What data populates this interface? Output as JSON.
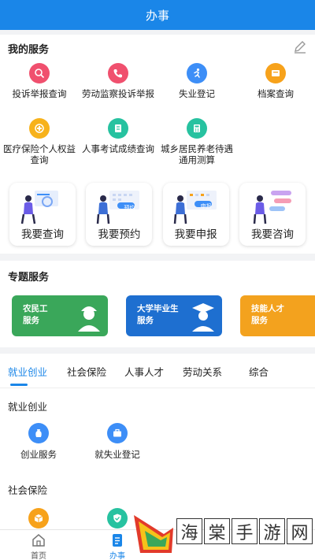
{
  "header": {
    "title": "办事"
  },
  "my_services": {
    "title": "我的服务",
    "items": [
      {
        "label": "投诉举报查询",
        "icon": "complaint-search-icon",
        "color": "#f0506e"
      },
      {
        "label": "劳动监察投诉举报",
        "icon": "phone-icon",
        "color": "#f0506e"
      },
      {
        "label": "失业登记",
        "icon": "runner-icon",
        "color": "#3d8ef7"
      },
      {
        "label": "档案查询",
        "icon": "archive-icon",
        "color": "#f7a21b"
      },
      {
        "label": "医疗保险个人权益查询",
        "icon": "medical-icon",
        "color": "#f7b21b"
      },
      {
        "label": "人事考试成绩查询",
        "icon": "exam-icon",
        "color": "#27c2a0"
      },
      {
        "label": "城乡居民养老待遇通用测算",
        "icon": "pension-calc-icon",
        "color": "#27c2a0"
      }
    ],
    "cards": [
      {
        "label": "我要查询",
        "icon": "query-illustration"
      },
      {
        "label": "我要预约",
        "icon": "appointment-illustration",
        "tag": "预约"
      },
      {
        "label": "我要申报",
        "icon": "declare-illustration",
        "tag": "申报"
      },
      {
        "label": "我要咨询",
        "icon": "consult-illustration"
      }
    ]
  },
  "special": {
    "title": "专题服务",
    "banners": [
      {
        "line1": "农民工",
        "line2": "服务",
        "color": "#3aa75a"
      },
      {
        "line1": "大学毕业生",
        "line2": "服务",
        "color": "#1e6fd0"
      },
      {
        "line1": "技能人才",
        "line2": "服务",
        "color": "#f3a21e"
      }
    ]
  },
  "tabs": {
    "items": [
      "就业创业",
      "社会保险",
      "人事人才",
      "劳动关系",
      "综合"
    ],
    "active": 0
  },
  "groups": [
    {
      "title": "就业创业",
      "items": [
        {
          "label": "创业服务",
          "icon": "vase-icon",
          "color": "#3d8ef7"
        },
        {
          "label": "就失业登记",
          "icon": "briefcase-icon",
          "color": "#3d8ef7"
        }
      ]
    },
    {
      "title": "社会保险",
      "items": [
        {
          "label": "",
          "icon": "box-icon",
          "color": "#f7a21b"
        },
        {
          "label": "",
          "icon": "shield-check-icon",
          "color": "#27c2a0"
        }
      ]
    }
  ],
  "bottom_nav": {
    "items": [
      {
        "label": "首页",
        "icon": "home-icon"
      },
      {
        "label": "办事",
        "icon": "task-icon"
      }
    ],
    "active": 1,
    "active_color": "#1a86e8"
  },
  "watermark": {
    "chars": [
      "海",
      "棠",
      "手",
      "游",
      "网"
    ]
  },
  "colors": {
    "primary": "#1a86e8",
    "background": "#f2f3f5"
  }
}
